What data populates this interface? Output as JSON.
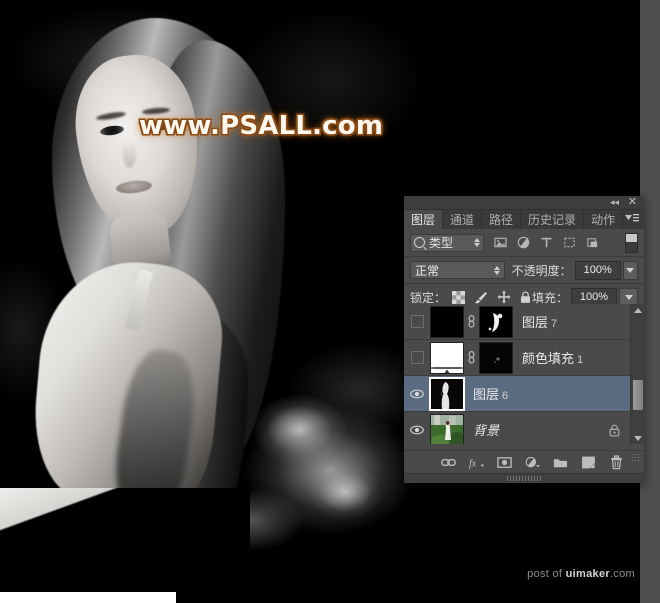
{
  "image": {
    "watermark": "www.PSALL.com",
    "credit_prefix": "post of ",
    "credit_brand": "uimaker",
    "credit_suffix": ".com"
  },
  "panel": {
    "collapse_icon": "◂◂",
    "close_icon": "✕",
    "menu_icon": "☰",
    "tabs": [
      {
        "label": "图层",
        "active": true
      },
      {
        "label": "通道",
        "active": false
      },
      {
        "label": "路径",
        "active": false
      },
      {
        "label": "历史记录",
        "active": false
      },
      {
        "label": "动作",
        "active": false
      }
    ],
    "filter": {
      "search_icon": "search-icon",
      "kind_label": "类型",
      "icons": [
        "pixel-filter-icon",
        "adjustment-filter-icon",
        "type-filter-icon",
        "shape-filter-icon",
        "smart-object-filter-icon"
      ],
      "toggle": "filter-enable-toggle"
    },
    "blend": {
      "mode": "正常",
      "opacity_label": "不透明度：",
      "opacity_value": "100%"
    },
    "lock": {
      "label": "锁定：",
      "icons": [
        "lock-transparent-pixels-icon",
        "lock-image-pixels-icon",
        "lock-position-icon",
        "lock-all-icon"
      ],
      "fill_label": "填充：",
      "fill_value": "100%"
    },
    "layers": [
      {
        "name": "图层",
        "suffix": "7",
        "visible": false,
        "selected": false,
        "has_mask": true,
        "locked": false,
        "thumb": "black",
        "italic": false
      },
      {
        "name": "颜色填充",
        "suffix": "1",
        "visible": false,
        "selected": false,
        "has_mask": true,
        "locked": false,
        "thumb": "gradient-fill",
        "italic": false
      },
      {
        "name": "图层",
        "suffix": "6",
        "visible": true,
        "selected": true,
        "has_mask": false,
        "locked": false,
        "thumb": "figure-bw",
        "italic": false
      },
      {
        "name": "背景",
        "suffix": "",
        "visible": true,
        "selected": false,
        "has_mask": false,
        "locked": true,
        "thumb": "photo-color",
        "italic": true
      }
    ],
    "bottom_icons": [
      "link-layers-icon",
      "layer-style-fx-icon",
      "add-layer-mask-icon",
      "new-adjustment-layer-icon",
      "new-group-icon",
      "new-layer-icon",
      "delete-layer-icon"
    ],
    "colors": {
      "panel_bg": "#4a4a4a",
      "tab_bg": "#3a3a3a",
      "selected_row": "#5b6b82",
      "text": "#eaeaea",
      "watermark_fill": "#fdf8ef",
      "watermark_stroke": "#8a4a14"
    }
  }
}
